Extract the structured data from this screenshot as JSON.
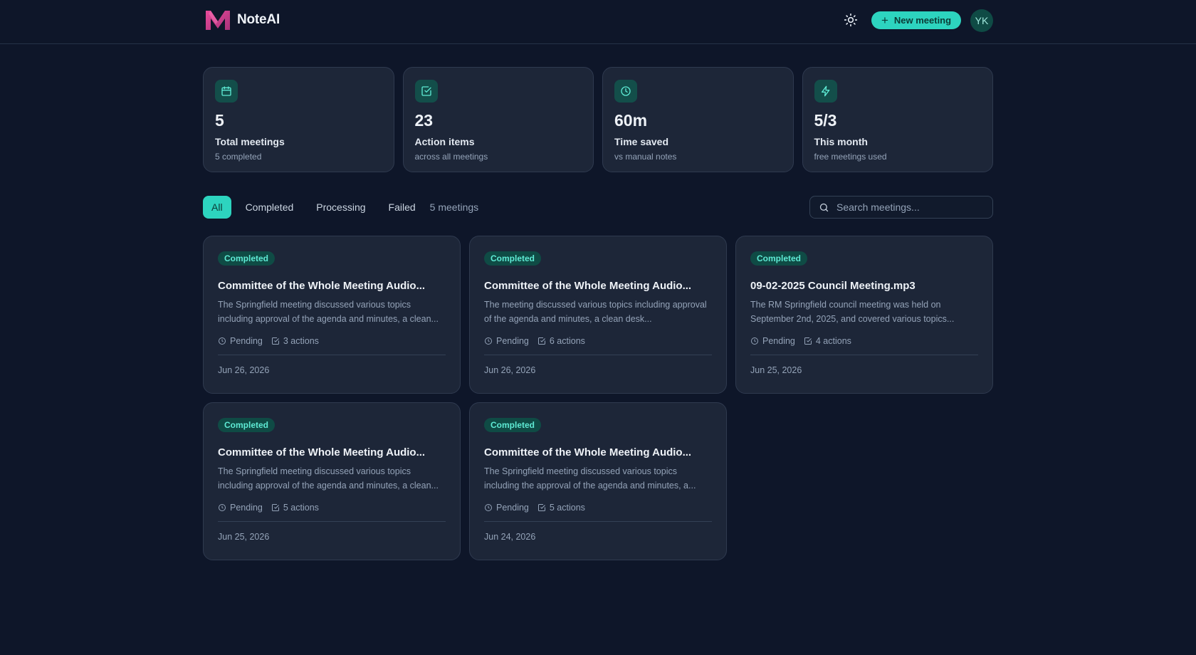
{
  "app": {
    "name": "NoteAI",
    "logo_icon": "m-logo-icon"
  },
  "header": {
    "theme_icon": "sun-icon",
    "new_meeting_label": "New meeting",
    "avatar_initials": "YK"
  },
  "stats": [
    {
      "icon": "calendar-icon",
      "value": "5",
      "label": "Total meetings",
      "sub": "5 completed"
    },
    {
      "icon": "check-square-icon",
      "value": "23",
      "label": "Action items",
      "sub": "across all meetings"
    },
    {
      "icon": "clock-icon",
      "value": "60m",
      "label": "Time saved",
      "sub": "vs manual notes"
    },
    {
      "icon": "lightning-icon",
      "value": "5/3",
      "label": "This month",
      "sub": "free meetings used"
    }
  ],
  "filters": {
    "tabs": [
      {
        "label": "All",
        "active": true
      },
      {
        "label": "Completed",
        "active": false
      },
      {
        "label": "Processing",
        "active": false
      },
      {
        "label": "Failed",
        "active": false
      }
    ],
    "count_label": "5 meetings"
  },
  "search": {
    "placeholder": "Search meetings..."
  },
  "meetings": [
    {
      "status": "Completed",
      "title": "Committee of the Whole Meeting Audio...",
      "summary": "The Springfield meeting discussed various topics including approval of the agenda and minutes, a clean...",
      "pending": "Pending",
      "actions": "3 actions",
      "date": "Jun 26, 2026"
    },
    {
      "status": "Completed",
      "title": "Committee of the Whole Meeting Audio...",
      "summary": "The meeting discussed various topics including approval of the agenda and minutes, a clean desk...",
      "pending": "Pending",
      "actions": "6 actions",
      "date": "Jun 26, 2026"
    },
    {
      "status": "Completed",
      "title": "09-02-2025 Council Meeting.mp3",
      "summary": "The RM Springfield council meeting was held on September 2nd, 2025, and covered various topics...",
      "pending": "Pending",
      "actions": "4 actions",
      "date": "Jun 25, 2026"
    },
    {
      "status": "Completed",
      "title": "Committee of the Whole Meeting Audio...",
      "summary": "The Springfield meeting discussed various topics including approval of the agenda and minutes, a clean...",
      "pending": "Pending",
      "actions": "5 actions",
      "date": "Jun 25, 2026"
    },
    {
      "status": "Completed",
      "title": "Committee of the Whole Meeting Audio...",
      "summary": "The Springfield meeting discussed various topics including the approval of the agenda and minutes, a...",
      "pending": "Pending",
      "actions": "5 actions",
      "date": "Jun 24, 2026"
    }
  ],
  "colors": {
    "background": "#0e1629",
    "card": "#1d2638",
    "accent": "#2dd4bf",
    "badge_bg": "#0f4b45",
    "logo_pink": "#d9468f"
  }
}
